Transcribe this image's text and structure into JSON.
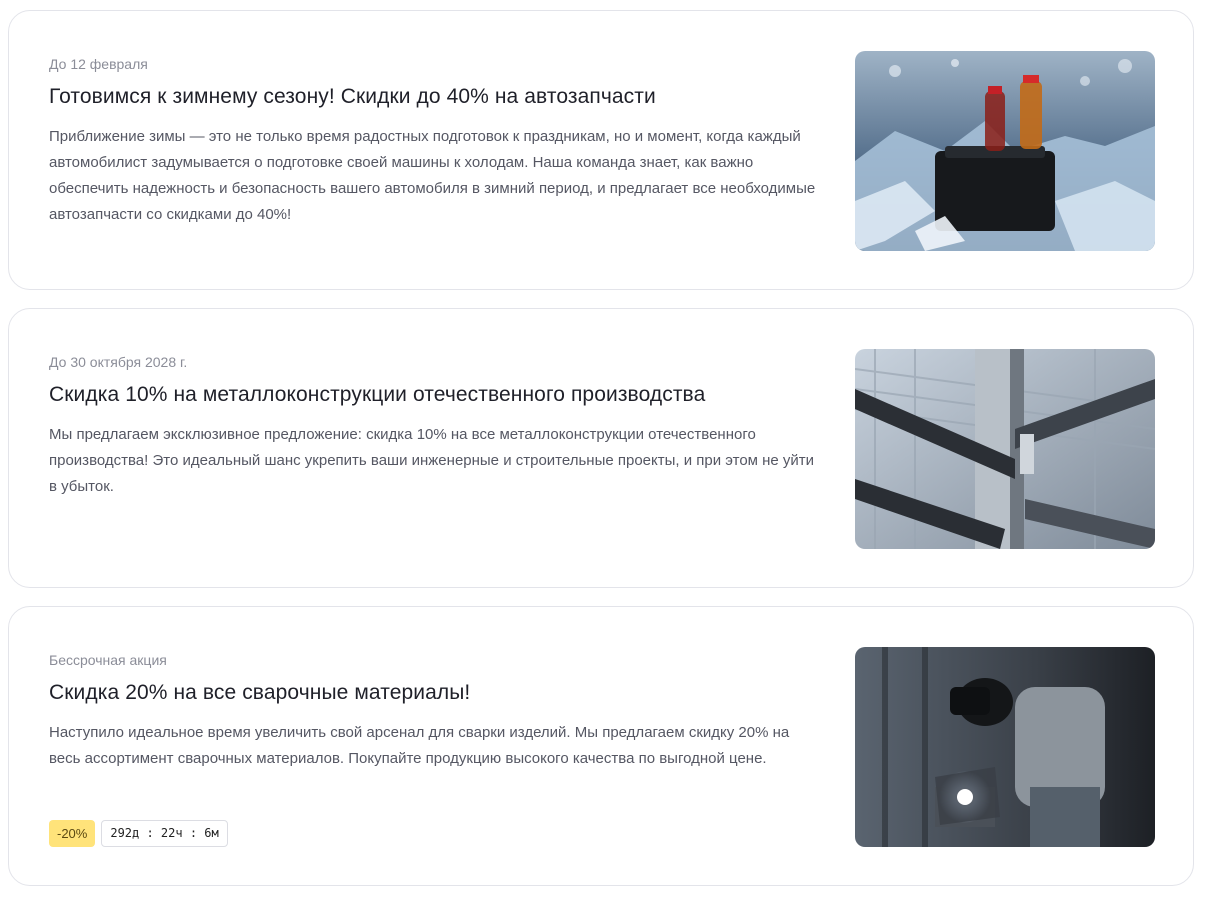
{
  "promotions": [
    {
      "date": "До 12 февраля",
      "title": "Готовимся к зимнему сезону! Скидки до 40% на автозапчасти",
      "description": "Приближение зимы — это не только время радостных подготовок к праздникам, но и момент, когда каждый автомобилист задумывается о подготовке своей машины к холодам. Наша команда знает, как важно обеспечить надежность и безопасность вашего автомобиля в зимний период, и предлагает все необходимые автозапчасти со скидками до 40%!",
      "image": "winter-autoparts-image"
    },
    {
      "date": "До 30 октября 2028 г.",
      "title": "Скидка 10% на металлоконструкции отечественного производства",
      "description": "Мы предлагаем эксклюзивное предложение: скидка 10% на все металлоконструкции отечественного производства! Это идеальный шанс укрепить ваши инженерные и строительные проекты, и при этом не уйти в убыток.",
      "image": "steel-structure-image"
    },
    {
      "date": "Бессрочная акция",
      "title": "Скидка 20% на все сварочные материалы!",
      "description": "Наступило идеальное время увеличить свой арсенал для сварки изделий. Мы предлагаем скидку 20% на весь ассортимент сварочных материалов. Покупайте продукцию высокого качества по выгодной цене.",
      "image": "welder-image",
      "discount_badge": "-20%",
      "timer": "292д : 22ч : 6м"
    }
  ],
  "colors": {
    "badge_bg": "#ffe37a",
    "border": "#e3e4ea",
    "muted": "#8b8d98"
  }
}
